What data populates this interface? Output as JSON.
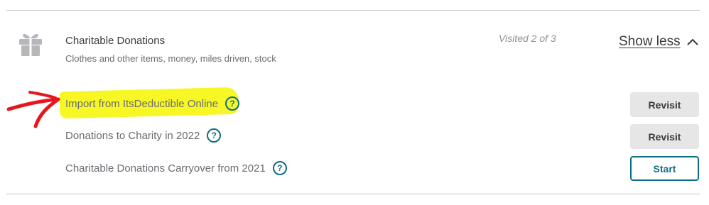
{
  "section": {
    "title": "Charitable Donations",
    "subtitle": "Clothes and other items, money, miles driven, stock",
    "visited": "Visited 2 of 3",
    "toggle_label": "Show less",
    "icon": "gift-icon"
  },
  "rows": [
    {
      "label": "Import from ItsDeductible Online",
      "button": "Revisit",
      "highlighted": true
    },
    {
      "label": "Donations to Charity in 2022",
      "button": "Revisit",
      "highlighted": false
    },
    {
      "label": "Charitable Donations Carryover from 2021",
      "button": "Start",
      "highlighted": false
    }
  ],
  "colors": {
    "accent": "#0d6f82",
    "highlight": "#f7f726",
    "annotation_arrow": "#e8161c",
    "revisit_bg": "#e6e6e6"
  }
}
